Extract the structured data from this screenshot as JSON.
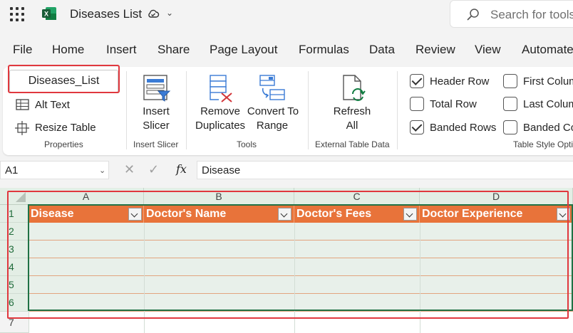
{
  "app": {
    "document_title": "Diseases List",
    "search_placeholder": "Search for tools"
  },
  "menu": [
    "File",
    "Home",
    "Insert",
    "Share",
    "Page Layout",
    "Formulas",
    "Data",
    "Review",
    "View",
    "Automate"
  ],
  "ribbon": {
    "properties": {
      "table_name": "Diseases_List",
      "alt_text": "Alt Text",
      "resize_table": "Resize Table",
      "label": "Properties"
    },
    "insert_slicer": {
      "button_line1": "Insert",
      "button_line2": "Slicer",
      "label": "Insert Slicer"
    },
    "tools": {
      "remove_line1": "Remove",
      "remove_line2": "Duplicates",
      "convert_line1": "Convert To",
      "convert_line2": "Range",
      "label": "Tools"
    },
    "external": {
      "refresh_line1": "Refresh",
      "refresh_line2": "All",
      "label": "External Table Data"
    },
    "style_options": {
      "header_row": "Header Row",
      "total_row": "Total Row",
      "banded_rows": "Banded Rows",
      "first_column": "First Colum",
      "last_column": "Last Colum",
      "banded_columns": "Banded Co",
      "label": "Table Style Opti"
    }
  },
  "formula_bar": {
    "name_box": "A1",
    "fx": "fx",
    "content": "Disease"
  },
  "grid": {
    "columns": [
      "A",
      "B",
      "C",
      "D"
    ],
    "rows": [
      "1",
      "2",
      "3",
      "4",
      "5",
      "6",
      "7"
    ],
    "headers": [
      "Disease",
      "Doctor's Name",
      "Doctor's Fees",
      "Doctor Experience"
    ]
  },
  "colors": {
    "table_header": "#e8733a",
    "table_band": "#e8f0ea",
    "excel_green": "#207245",
    "highlight_red": "#e0383e"
  }
}
